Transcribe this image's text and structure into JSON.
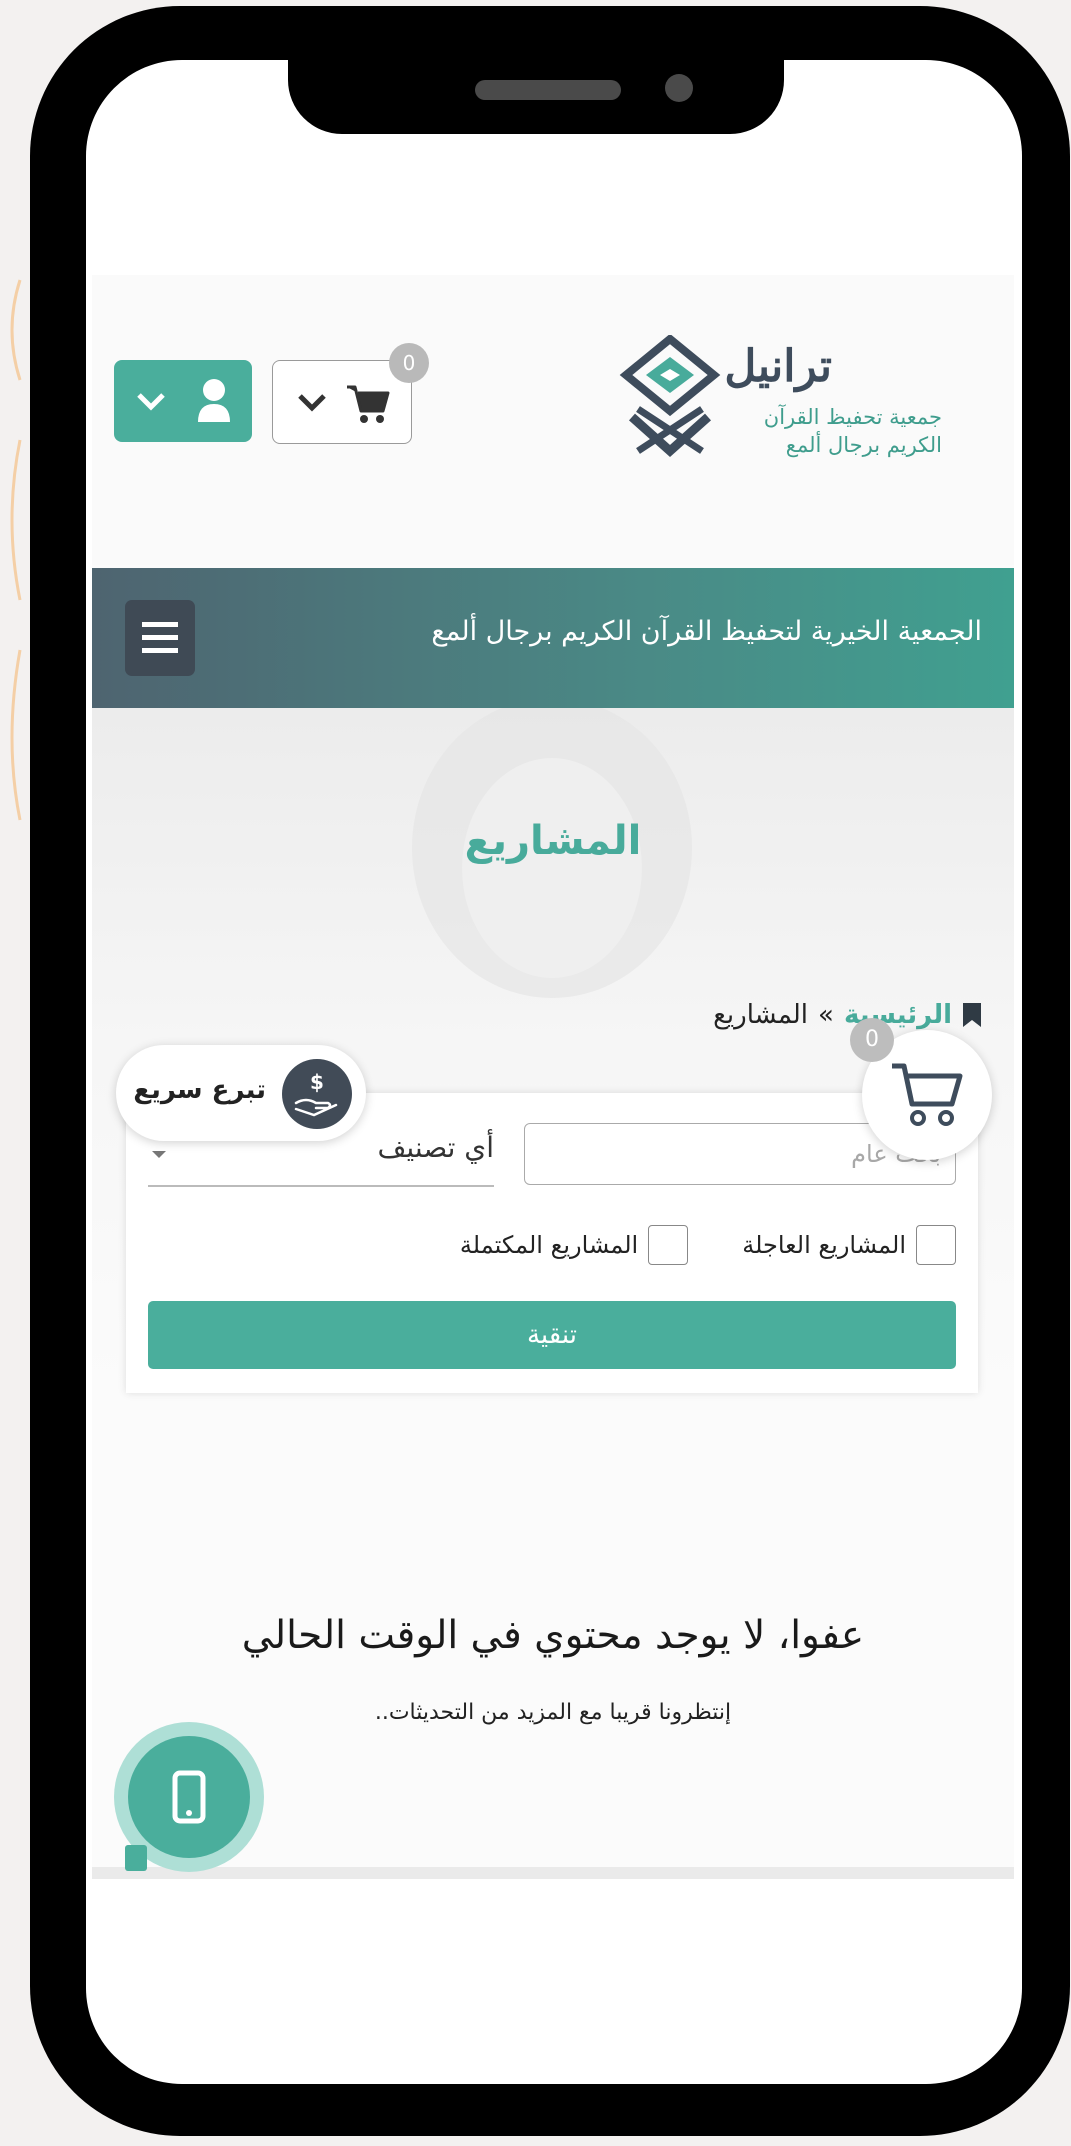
{
  "logo": {
    "title": "ترانيل",
    "subtitle_line1": "جمعية تحفيظ القرآن",
    "subtitle_line2": "الكريم برجال ألمع"
  },
  "header": {
    "cart_count": "0",
    "cart_icon": "cart-icon",
    "user_icon": "user-icon"
  },
  "navbar": {
    "title": "الجمعية الخيرية لتحفيظ القرآن الكريم برجال ألمع",
    "menu_icon": "hamburger-icon"
  },
  "hero": {
    "title": "المشاريع"
  },
  "breadcrumb": {
    "home": "الرئيسية",
    "separator": "»",
    "current": "المشاريع"
  },
  "filter": {
    "search_placeholder": "بحث عام",
    "category_label": "أي تصنيف",
    "urgent_label": "المشاريع العاجلة",
    "completed_label": "المشاريع المكتملة",
    "urgent_checked": false,
    "completed_checked": false,
    "button_label": "تنقية"
  },
  "empty_state": {
    "title": "عفوا، لا يوجد محتوي في الوقت الحالي",
    "subtitle": "إنتظرونا قريبا مع المزيد من التحديثات.."
  },
  "floating": {
    "donate_label": "تبرع سريع",
    "cart_count": "0"
  },
  "colors": {
    "accent": "#4aae9c",
    "dark": "#414b57"
  }
}
